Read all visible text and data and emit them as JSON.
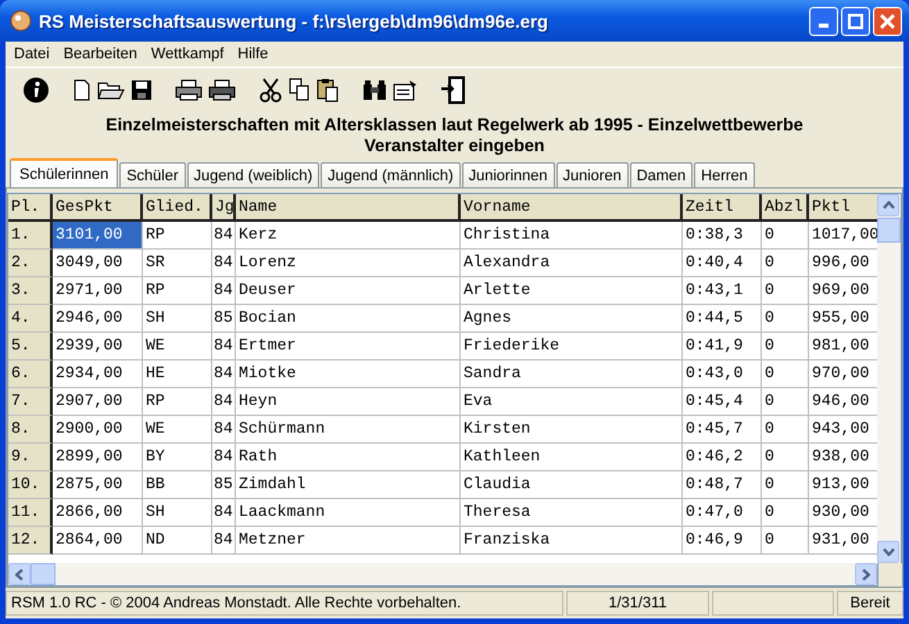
{
  "window": {
    "title": "RS Meisterschaftsauswertung - f:\\rs\\ergeb\\dm96\\dm96e.erg"
  },
  "menu": [
    "Datei",
    "Bearbeiten",
    "Wettkampf",
    "Hilfe"
  ],
  "heading": [
    "Einzelmeisterschaften mit Altersklassen laut Regelwerk ab 1995 - Einzelwettbewerbe",
    "Veranstalter eingeben"
  ],
  "tabs": [
    {
      "label": "Schülerinnen",
      "selected": true
    },
    {
      "label": "Schüler",
      "selected": false
    },
    {
      "label": "Jugend (weiblich)",
      "selected": false
    },
    {
      "label": "Jugend (männlich)",
      "selected": false
    },
    {
      "label": "Juniorinnen",
      "selected": false
    },
    {
      "label": "Junioren",
      "selected": false
    },
    {
      "label": "Damen",
      "selected": false
    },
    {
      "label": "Herren",
      "selected": false
    }
  ],
  "table": {
    "columns": [
      "Pl.",
      "GesPkt",
      "Glied.",
      "Jg",
      "Name",
      "Vorname",
      "Zeitl",
      "Abzl",
      "Pktl"
    ],
    "rows": [
      {
        "selected": true,
        "cells": [
          "1.",
          "3101,00",
          "RP",
          "84",
          "Kerz",
          "Christina",
          "0:38,3",
          "0",
          "1017,00"
        ]
      },
      {
        "selected": false,
        "cells": [
          "2.",
          "3049,00",
          "SR",
          "84",
          "Lorenz",
          "Alexandra",
          "0:40,4",
          "0",
          "996,00"
        ]
      },
      {
        "selected": false,
        "cells": [
          "3.",
          "2971,00",
          "RP",
          "84",
          "Deuser",
          "Arlette",
          "0:43,1",
          "0",
          "969,00"
        ]
      },
      {
        "selected": false,
        "cells": [
          "4.",
          "2946,00",
          "SH",
          "85",
          "Bocian",
          "Agnes",
          "0:44,5",
          "0",
          "955,00"
        ]
      },
      {
        "selected": false,
        "cells": [
          "5.",
          "2939,00",
          "WE",
          "84",
          "Ertmer",
          "Friederike",
          "0:41,9",
          "0",
          "981,00"
        ]
      },
      {
        "selected": false,
        "cells": [
          "6.",
          "2934,00",
          "HE",
          "84",
          "Miotke",
          "Sandra",
          "0:43,0",
          "0",
          "970,00"
        ]
      },
      {
        "selected": false,
        "cells": [
          "7.",
          "2907,00",
          "RP",
          "84",
          "Heyn",
          "Eva",
          "0:45,4",
          "0",
          "946,00"
        ]
      },
      {
        "selected": false,
        "cells": [
          "8.",
          "2900,00",
          "WE",
          "84",
          "Schürmann",
          "Kirsten",
          "0:45,7",
          "0",
          "943,00"
        ]
      },
      {
        "selected": false,
        "cells": [
          "9.",
          "2899,00",
          "BY",
          "84",
          "Rath",
          "Kathleen",
          "0:46,2",
          "0",
          "938,00"
        ]
      },
      {
        "selected": false,
        "cells": [
          "10.",
          "2875,00",
          "BB",
          "85",
          "Zimdahl",
          "Claudia",
          "0:48,7",
          "0",
          "913,00"
        ]
      },
      {
        "selected": false,
        "cells": [
          "11.",
          "2866,00",
          "SH",
          "84",
          "Laackmann",
          "Theresa",
          "0:47,0",
          "0",
          "930,00"
        ]
      },
      {
        "selected": false,
        "cells": [
          "12.",
          "2864,00",
          "ND",
          "84",
          "Metzner",
          "Franziska",
          "0:46,9",
          "0",
          "931,00"
        ]
      }
    ]
  },
  "status_bar": [
    "RSM 1.0 RC - © 2004 Andreas Monstadt. Alle Rechte vorbehalten.",
    "1/31/311",
    "Bereit"
  ]
}
